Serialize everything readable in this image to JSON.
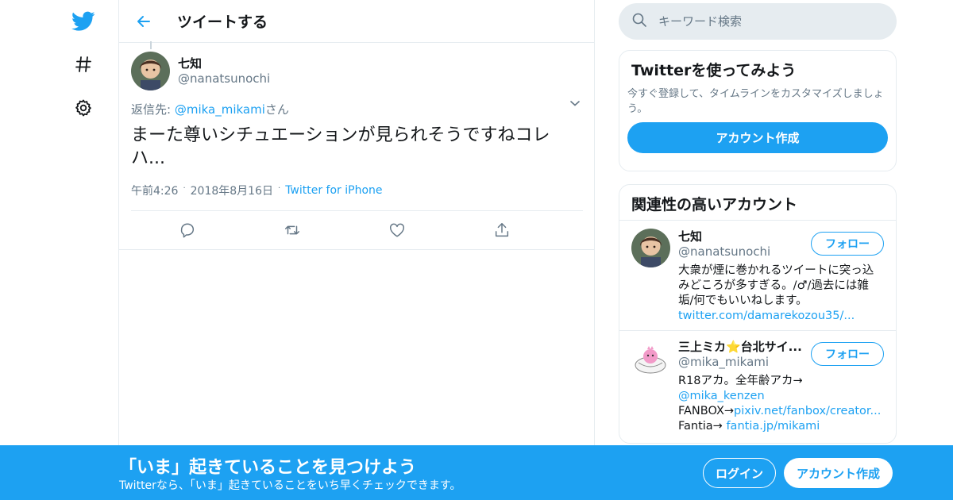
{
  "colors": {
    "accent": "#1da1f2",
    "text": "#14171a",
    "muted": "#657786",
    "border": "#e6ecf0"
  },
  "nav": {
    "items": [
      {
        "icon": "twitter-bird-icon"
      },
      {
        "icon": "hashtag-icon"
      },
      {
        "icon": "gear-icon"
      }
    ]
  },
  "header": {
    "title": "ツイートする",
    "back_icon": "arrow-left-icon"
  },
  "tweet": {
    "display_name": "七知",
    "handle": "@nanatsunochi",
    "reply_prefix": "返信先: ",
    "reply_user": "@mika_mikami",
    "reply_suffix": "さん",
    "text": "まーた尊いシチュエーションが見られそうですねコレハ...",
    "time": "午前4:26",
    "date": "2018年8月16日",
    "source": "Twitter for iPhone",
    "actions": [
      "reply-icon",
      "retweet-icon",
      "like-icon",
      "share-icon"
    ]
  },
  "search": {
    "placeholder": "キーワード検索"
  },
  "signup_card": {
    "title": "Twitterを使ってみよう",
    "subtitle": "今すぐ登録して、タイムラインをカスタマイズしましょう。",
    "button": "アカウント作成"
  },
  "related": {
    "title": "関連性の高いアカウント",
    "accounts": [
      {
        "name": "七知",
        "handle": "@nanatsunochi",
        "follow": "フォロー",
        "bio": "大衆が煙に巻かれるツイートに突っ込みどころが多すぎる。/♂/過去には雑垢/何でもいいねします。",
        "link": "twitter.com/damarekozou35/..."
      },
      {
        "name": "三上ミカ⭐台北サイ...",
        "handle": "@mika_mikami",
        "follow": "フォロー",
        "bio1": "R18アカ。全年齢アカ→",
        "link1": "@mika_kenzen",
        "bio2": "FANBOX→",
        "link2": "pixiv.net/fanbox/creator...",
        "bio3": "Fantia→ ",
        "link3": "fantia.jp/mikami"
      }
    ]
  },
  "banner": {
    "title": "「いま」起きていることを見つけよう",
    "subtitle": "Twitterなら、「いま」起きていることをいち早くチェックできます。",
    "login": "ログイン",
    "signup": "アカウント作成"
  }
}
